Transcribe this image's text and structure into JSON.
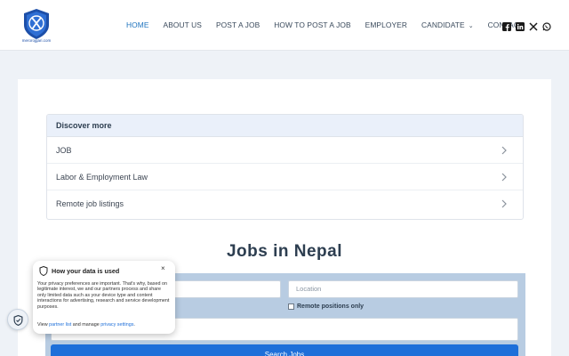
{
  "header": {
    "logo_text": "merorojgari.com",
    "nav": [
      {
        "label": "HOME",
        "active": true
      },
      {
        "label": "ABOUT US"
      },
      {
        "label": "POST A JOB"
      },
      {
        "label": "HOW TO POST A JOB"
      },
      {
        "label": "EMPLOYER"
      },
      {
        "label": "CANDIDATE",
        "has_dropdown": true
      },
      {
        "label": "CONTACT"
      }
    ],
    "social_icons": [
      "facebook-icon",
      "linkedin-icon",
      "x-icon",
      "whatsapp-icon"
    ],
    "accent_color": "#1e73be"
  },
  "discover": {
    "title": "Discover more",
    "items": [
      {
        "label": "JOB"
      },
      {
        "label": "Labor & Employment Law"
      },
      {
        "label": "Remote job listings"
      }
    ]
  },
  "jobs": {
    "title": "Jobs in Nepal",
    "location_placeholder": "Location",
    "remote_label": "Remote positions only",
    "search_button": "Search Jobs"
  },
  "privacy": {
    "title": "How your data is used",
    "close": "×",
    "body": "Your privacy preferences are important. That's why, based on legitimate interest, we and our partners process and share only limited data such as your device type and content interactions for advertising, research and service development purposes.",
    "footer_prefix": "View ",
    "partner_link": "partner list",
    "footer_mid": " and manage ",
    "settings_link": "privacy settings",
    "footer_suffix": "."
  }
}
